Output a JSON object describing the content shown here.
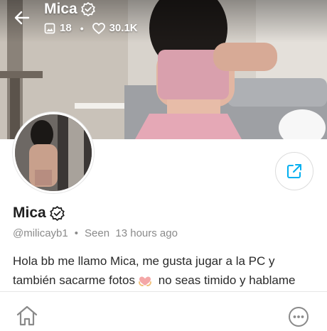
{
  "cover": {
    "title": "Mica",
    "media_count": "18",
    "likes_count": "30.1K",
    "icons": [
      "back-arrow-icon",
      "verified-icon",
      "image-icon",
      "heart-icon"
    ]
  },
  "profile": {
    "display_name": "Mica",
    "handle": "@milicayb1",
    "separator": "•",
    "last_seen": "Seen  13 hours ago",
    "bio_line_1": "Hola bb me llamo Mica, me gusta jugar a la PC y",
    "bio_line_2a": "también sacarme fotos",
    "bio_line_2b": " no seas timido y hablame"
  },
  "nav": {
    "icons": [
      "home-icon",
      "more-options-icon",
      "share-icon"
    ]
  },
  "colors": {
    "accent": "#00aff0",
    "text_primary": "#1f1f1f",
    "text_muted": "#8a8a8a",
    "divider": "#e6e6e6"
  }
}
